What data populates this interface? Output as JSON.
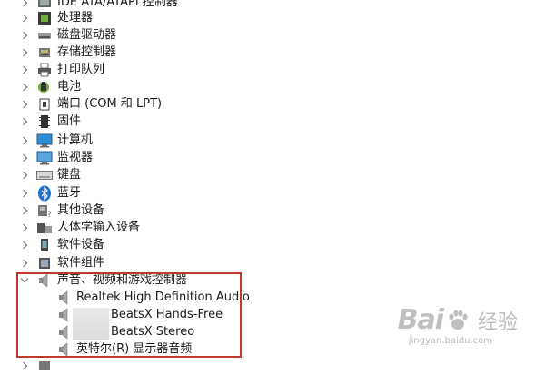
{
  "tree": {
    "categories": [
      {
        "label": "IDE ATA/ATAPI 控制器",
        "icon": "ide-controller-icon"
      },
      {
        "label": "处理器",
        "icon": "processor-icon"
      },
      {
        "label": "磁盘驱动器",
        "icon": "disk-drive-icon"
      },
      {
        "label": "存储控制器",
        "icon": "storage-controller-icon"
      },
      {
        "label": "打印队列",
        "icon": "printer-icon"
      },
      {
        "label": "电池",
        "icon": "battery-icon"
      },
      {
        "label": "端口 (COM 和 LPT)",
        "icon": "port-icon"
      },
      {
        "label": "固件",
        "icon": "firmware-icon"
      },
      {
        "label": "计算机",
        "icon": "computer-icon"
      },
      {
        "label": "监视器",
        "icon": "monitor-icon"
      },
      {
        "label": "键盘",
        "icon": "keyboard-icon"
      },
      {
        "label": "蓝牙",
        "icon": "bluetooth-icon"
      },
      {
        "label": "其他设备",
        "icon": "other-devices-icon"
      },
      {
        "label": "人体学输入设备",
        "icon": "hid-icon"
      },
      {
        "label": "软件设备",
        "icon": "software-device-icon"
      },
      {
        "label": "软件组件",
        "icon": "software-component-icon"
      }
    ],
    "expanded": {
      "label": "声音、视频和游戏控制器",
      "icon": "speaker-icon",
      "children": [
        {
          "label": "Realtek High Definition Audio",
          "icon": "speaker-icon"
        },
        {
          "label": "BeatsX Hands-Free",
          "icon": "speaker-icon"
        },
        {
          "label": "BeatsX Stereo",
          "icon": "speaker-icon"
        },
        {
          "label": "英特尔(R) 显示器音频",
          "icon": "speaker-icon"
        }
      ]
    }
  },
  "watermark": {
    "brand_a": "Bai",
    "brand_b": "du",
    "brand_text": "经验",
    "url": "jingyan.baidu.com"
  },
  "colors": {
    "highlight": "#c0392b",
    "monitor_blue": "#2f8fd6",
    "bluetooth": "#1f6fd0"
  }
}
